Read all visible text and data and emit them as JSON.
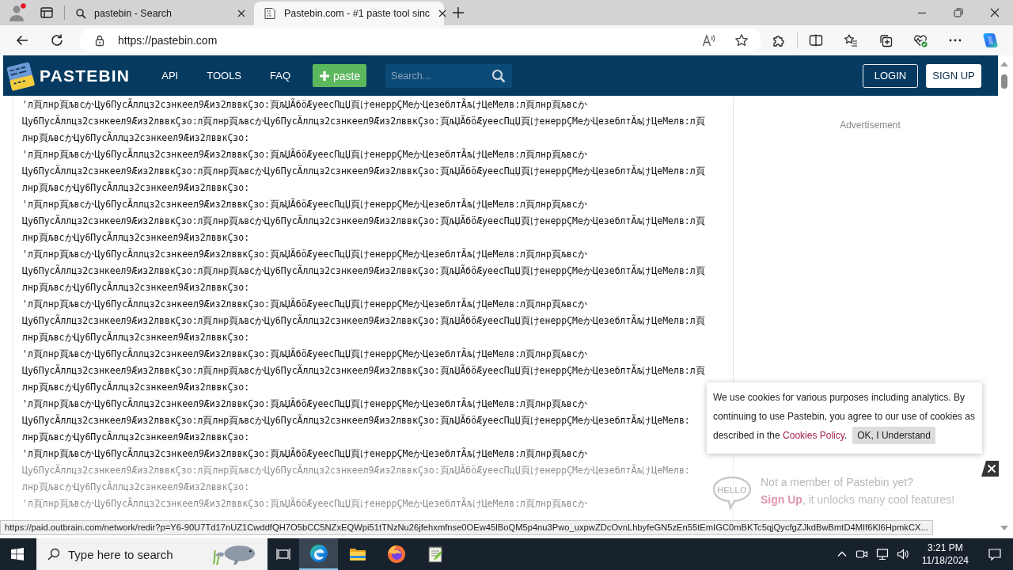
{
  "browser": {
    "tabs": [
      {
        "kind": "search",
        "title": "pastebin - Search",
        "selected": false
      },
      {
        "kind": "page",
        "title": "Pastebin.com - #1 paste tool sinc",
        "selected": true
      }
    ],
    "url": "https://pastebin.com",
    "status_url": "https://paid.outbrain.com/network/redir?p=Y6-90U7Td17nUZ1CwddfQH7O5bCC5NZxEQWpi51tTNzNu26jfehxmfnse0OEw45lBoQM5p4nu3Pwo_uxpwZDcOvnLhbyfeGN5zEn55tEmIGC0mBKTc5qjQycfgZJkdBwBmtD4MIf6Kl6HpmkCX..."
  },
  "header": {
    "logo": "PASTEBIN",
    "nav": [
      "API",
      "TOOLS",
      "FAQ"
    ],
    "paste_button": "paste",
    "search": {
      "placeholder": "Search..."
    },
    "login": "LOGIN",
    "signup": "SIGN UP"
  },
  "paste_lines": [
    "'л頁лнр頁љвсかЦу6ПусÃллцз2сзнкеел9Æиз2лввкÇзо:頁љЏÃбöÆуеесПцЏ頁けенеррÇМеかЦезеблтÃљけЦеМелв:л頁лнр頁љвсか",
    "Цу6ПусÃллцз2сзнкеел9Æиз2лввкÇзо:л頁лнр頁љвсかЦу6ПусÃллцз2сзнкеел9Æиз2лввкÇзо:頁љЏÃбöÆуеесПцЏ頁けенеррÇМеかЦезеблтÃљけЦеМелв:л頁",
    "лнр頁љвсかЦу6ПусÃллцз2сзнкеел9Æиз2лввкÇзо:",
    "'л頁лнр頁љвсかЦу6ПусÃллцз2сзнкеел9Æиз2лввкÇзо:頁љЏÃбöÆуеесПцЏ頁けенеррÇМеかЦезеблтÃљけЦеМелв:л頁лнр頁љвсか",
    "Цу6ПусÃллцз2сзнкеел9Æиз2лввкÇзо:л頁лнр頁љвсかЦу6ПусÃллцз2сзнкеел9Æиз2лввкÇзо:頁љЏÃбöÆуеесПцЏ頁けенеррÇМеかЦезеблтÃљけЦеМелв:л頁",
    "лнр頁љвсかЦу6ПусÃллцз2сзнкеел9Æиз2лввкÇзо:",
    "'л頁лнр頁љвсかЦу6ПусÃллцз2сзнкеел9Æиз2лввкÇзо:頁љЏÃбöÆуеесПцЏ頁けенеррÇМеかЦезеблтÃљけЦеМелв:л頁лнр頁љвсか",
    "Цу6ПусÃллцз2сзнкеел9Æиз2лввкÇзо:л頁лнр頁љвсかЦу6ПусÃллцз2сзнкеел9Æиз2лввкÇзо:頁љЏÃбöÆуеесПцЏ頁けенеррÇМеかЦезеблтÃљけЦеМелв:л頁",
    "лнр頁љвсかЦу6ПусÃллцз2сзнкеел9Æиз2лввкÇзо:",
    "'л頁лнр頁љвсかЦу6ПусÃллцз2сзнкеел9Æиз2лввкÇзо:頁љЏÃбöÆуеесПцЏ頁けенеррÇМеかЦезеблтÃљけЦеМелв:л頁лнр頁љвсか",
    "Цу6ПусÃллцз2сзнкеел9Æиз2лввкÇзо:л頁лнр頁љвсかЦу6ПусÃллцз2сзнкеел9Æиз2лввкÇзо:頁љЏÃбöÆуеесПцЏ頁けенеррÇМеかЦезеблтÃљけЦеМелв:л頁",
    "лнр頁љвсかЦу6ПусÃллцз2сзнкеел9Æиз2лввкÇзо:",
    "'л頁лнр頁љвсかЦу6ПусÃллцз2сзнкеел9Æиз2лввкÇзо:頁љЏÃбöÆуеесПцЏ頁けенеррÇМеかЦезеблтÃљけЦеМелв:л頁лнр頁љвсか",
    "Цу6ПусÃллцз2сзнкеел9Æиз2лввкÇзо:л頁лнр頁љвсかЦу6ПусÃллцз2сзнкеел9Æиз2лввкÇзо:頁љЏÃбöÆуеесПцЏ頁けенеррÇМеかЦезеблтÃљけЦеМелв:л頁",
    "лнр頁љвсかЦу6ПусÃллцз2сзнкеел9Æиз2лввкÇзо:",
    "'л頁лнр頁љвсかЦу6ПусÃллцз2сзнкеел9Æиз2лввкÇзо:頁љЏÃбöÆуеесПцЏ頁けенеррÇМеかЦезеблтÃљけЦеМелв:л頁лнр頁љвсか",
    "Цу6ПусÃллцз2сзнкеел9Æиз2лввкÇзо:л頁лнр頁љвсかЦу6ПусÃллцз2сзнкеел9Æиз2лввкÇзо:頁љЏÃбöÆуеесПцЏ頁けенеррÇМеかЦезеблтÃљけЦеМелв:л頁",
    "лнр頁љвсかЦу6ПусÃллцз2сзнкеел9Æиз2лввкÇзо:",
    "'л頁лнр頁љвсかЦу6ПусÃллцз2сзнкеел9Æиз2лввкÇзо:頁љЏÃбöÆуеесПцЏ頁けенеррÇМеかЦезеблтÃљけЦеМелв:л頁лнр頁љвсか",
    "Цу6ПусÃллцз2сзнкеел9Æиз2лввкÇзо:л頁лнр頁љвсかЦу6ПусÃллцз2сзнкеел9Æиз2лввкÇзо:頁љЏÃбöÆуеесПцЏ頁けенеррÇМеかЦезеблтÃљけЦеМелв:",
    "лнр頁љвсかЦу6ПусÃллцз2сзнкеел9Æиз2лввкÇзо:",
    "'л頁лнр頁љвсかЦу6ПусÃллцз2сзнкеел9Æиз2лввкÇзо:頁љЏÃбöÆуеесПцЏ頁けенеррÇМеかЦезеблтÃљけЦеМелв:л頁лнр頁љвсか",
    "Цу6ПусÃллцз2сзнкеел9Æиз2лввкÇзо:л頁лнр頁љвсかЦу6ПусÃллцз2сзнкеел9Æиз2лввкÇзо:頁љЏÃбöÆуеесПцЏ頁けенеррÇМеかЦезеблтÃљけЦеМелв:",
    "лнр頁љвсかЦу6ПусÃллцз2сзнкеел9Æиз2лввкÇзо:",
    "'л頁лнр頁љвсかЦу6ПусÃллцз2сзнкеел9Æиз2лввкÇзо:頁љЏÃбöÆуеесПцЏ頁けенеррÇМеかЦезеблтÃљけЦеМелв:л頁лнр頁љвсか"
  ],
  "sidebar": {
    "ad_label": "Advertisement"
  },
  "cookie_banner": {
    "text": "We use cookies for various purposes including analytics. By continuing to use Pastebin, you agree to our use of cookies as described in the",
    "link": "Cookies Policy",
    "text_end": ".",
    "button": "OK, I Understand"
  },
  "signup_bar": {
    "bubble": "HELLO",
    "question": "Not a member of Pastebin yet?",
    "link": "Sign Up",
    "text": ", it unlocks many cool features!"
  },
  "taskbar": {
    "search": {
      "placeholder": "Type here to search"
    },
    "apps": [
      {
        "kind": "browser",
        "selected": true
      },
      {
        "kind": "folder",
        "selected": false
      },
      {
        "kind": "fox",
        "selected": false
      },
      {
        "kind": "notepad",
        "selected": false
      }
    ],
    "time": "3:21 PM",
    "date": "11/18/2024"
  }
}
